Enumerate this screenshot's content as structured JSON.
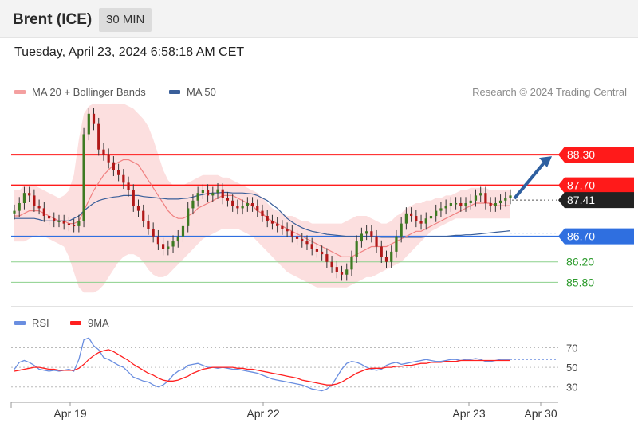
{
  "header": {
    "title": "Brent (ICE)",
    "interval": "30 MIN"
  },
  "datetime": "Tuesday, April 23, 2024 6:58:18 AM CET",
  "legend": {
    "ma20": {
      "label": "MA 20 + Bollinger Bands",
      "color": "#f08080"
    },
    "ma50": {
      "label": "MA 50",
      "color": "#3a5f9a"
    }
  },
  "credit": "Research © 2024 Trading Central",
  "rsi_legend": {
    "rsi": {
      "label": "RSI",
      "color": "#6a8ee0"
    },
    "ma9": {
      "label": "9MA",
      "color": "#ff2020"
    }
  },
  "chart_data": [
    {
      "type": "candlestick",
      "ylim": [
        85.4,
        89.3
      ],
      "levels": [
        {
          "value": 88.3,
          "label": "88.30",
          "kind": "resistance",
          "color": "#ff1a1a"
        },
        {
          "value": 87.7,
          "label": "87.70",
          "kind": "resistance",
          "color": "#ff1a1a"
        },
        {
          "value": 87.41,
          "label": "87.41",
          "kind": "last",
          "color": "#222222"
        },
        {
          "value": 86.7,
          "label": "86.70",
          "kind": "pivot",
          "color": "#2f6fe0"
        },
        {
          "value": 86.2,
          "label": "86.20",
          "kind": "support",
          "color": "#2eaa2e"
        },
        {
          "value": 85.8,
          "label": "85.80",
          "kind": "support",
          "color": "#2eaa2e"
        }
      ],
      "xticks": [
        "Apr 19",
        "Apr 22",
        "Apr 23",
        "Apr 30"
      ],
      "series_close": [
        87.2,
        87.35,
        87.55,
        87.5,
        87.3,
        87.25,
        87.1,
        87.05,
        87.0,
        87.0,
        86.95,
        86.92,
        86.9,
        87.0,
        88.7,
        89.1,
        88.9,
        88.4,
        88.3,
        88.15,
        88.0,
        87.9,
        87.75,
        87.6,
        87.3,
        87.2,
        87.0,
        86.85,
        86.7,
        86.55,
        86.45,
        86.5,
        86.6,
        86.7,
        86.9,
        87.25,
        87.4,
        87.55,
        87.6,
        87.5,
        87.55,
        87.62,
        87.45,
        87.4,
        87.3,
        87.25,
        87.3,
        87.35,
        87.3,
        87.2,
        87.1,
        87.0,
        86.95,
        86.9,
        86.85,
        86.8,
        86.7,
        86.65,
        86.6,
        86.55,
        86.45,
        86.4,
        86.35,
        86.2,
        86.1,
        86.0,
        85.95,
        86.05,
        86.3,
        86.6,
        86.75,
        86.8,
        86.7,
        86.5,
        86.3,
        86.2,
        86.4,
        86.7,
        86.95,
        87.15,
        87.1,
        87.0,
        86.95,
        87.05,
        87.1,
        87.2,
        87.25,
        87.3,
        87.35,
        87.35,
        87.3,
        87.35,
        87.4,
        87.5,
        87.55,
        87.35,
        87.3,
        87.35,
        87.4,
        87.45,
        87.5
      ],
      "ma20": [
        87.1,
        87.1,
        87.15,
        87.2,
        87.2,
        87.2,
        87.15,
        87.1,
        87.05,
        87.0,
        87.0,
        86.95,
        86.95,
        87.0,
        87.2,
        87.4,
        87.6,
        87.75,
        87.9,
        88.0,
        88.1,
        88.15,
        88.2,
        88.2,
        88.15,
        88.1,
        87.95,
        87.8,
        87.65,
        87.5,
        87.35,
        87.2,
        87.1,
        87.05,
        87.05,
        87.1,
        87.15,
        87.25,
        87.3,
        87.35,
        87.4,
        87.45,
        87.5,
        87.5,
        87.5,
        87.45,
        87.4,
        87.35,
        87.3,
        87.2,
        87.15,
        87.05,
        87.0,
        86.95,
        86.9,
        86.85,
        86.8,
        86.75,
        86.7,
        86.65,
        86.6,
        86.55,
        86.5,
        86.45,
        86.4,
        86.35,
        86.3,
        86.3,
        86.3,
        86.35,
        86.4,
        86.45,
        86.5,
        86.5,
        86.5,
        86.5,
        86.55,
        86.6,
        86.65,
        86.7,
        86.75,
        86.8,
        86.8,
        86.85,
        86.9,
        86.95,
        87.0,
        87.05,
        87.1,
        87.15,
        87.2,
        87.25,
        87.3,
        87.35,
        87.35,
        87.35,
        87.35,
        87.3,
        87.3,
        87.3,
        87.3
      ],
      "upper_band": [
        87.6,
        87.6,
        87.7,
        87.7,
        87.7,
        87.65,
        87.6,
        87.55,
        87.5,
        87.45,
        87.5,
        87.6,
        87.9,
        88.6,
        89.1,
        89.25,
        89.3,
        89.3,
        89.3,
        89.3,
        89.3,
        89.3,
        89.3,
        89.25,
        89.2,
        89.1,
        89.0,
        88.85,
        88.6,
        88.3,
        88.0,
        87.8,
        87.7,
        87.7,
        87.7,
        87.75,
        87.8,
        87.85,
        87.9,
        87.9,
        87.9,
        87.9,
        87.85,
        87.85,
        87.8,
        87.75,
        87.7,
        87.65,
        87.6,
        87.55,
        87.45,
        87.35,
        87.25,
        87.2,
        87.15,
        87.1,
        87.1,
        87.05,
        87.0,
        87.0,
        86.95,
        86.95,
        86.95,
        86.95,
        86.95,
        86.95,
        86.95,
        87.0,
        87.05,
        87.1,
        87.1,
        87.1,
        87.05,
        87.0,
        86.95,
        86.95,
        87.0,
        87.1,
        87.15,
        87.25,
        87.3,
        87.35,
        87.35,
        87.4,
        87.4,
        87.45,
        87.45,
        87.5,
        87.5,
        87.55,
        87.6,
        87.6,
        87.65,
        87.65,
        87.65,
        87.65,
        87.6,
        87.6,
        87.6,
        87.6,
        87.6
      ],
      "lower_band": [
        86.6,
        86.6,
        86.6,
        86.65,
        86.7,
        86.72,
        86.7,
        86.65,
        86.6,
        86.55,
        86.5,
        86.3,
        86.0,
        85.7,
        85.6,
        85.6,
        85.6,
        85.65,
        85.75,
        85.9,
        86.05,
        86.2,
        86.3,
        86.35,
        86.35,
        86.3,
        86.2,
        86.05,
        85.95,
        85.9,
        85.9,
        85.95,
        86.05,
        86.15,
        86.25,
        86.35,
        86.45,
        86.55,
        86.65,
        86.7,
        86.75,
        86.8,
        86.85,
        86.85,
        86.85,
        86.85,
        86.8,
        86.75,
        86.7,
        86.6,
        86.5,
        86.4,
        86.3,
        86.2,
        86.1,
        86.0,
        85.95,
        85.9,
        85.85,
        85.8,
        85.75,
        85.7,
        85.7,
        85.7,
        85.7,
        85.7,
        85.7,
        85.7,
        85.75,
        85.8,
        85.85,
        85.9,
        85.9,
        85.95,
        86.0,
        86.05,
        86.1,
        86.15,
        86.2,
        86.3,
        86.4,
        86.5,
        86.6,
        86.7,
        86.8,
        86.85,
        86.9,
        86.95,
        87.0,
        87.05,
        87.05,
        87.05,
        87.05,
        87.05,
        87.05,
        87.05,
        87.05,
        87.05,
        87.05,
        87.05,
        87.05
      ],
      "ma50": [
        87.05,
        87.05,
        87.05,
        87.05,
        87.05,
        87.03,
        87.0,
        87.0,
        87.0,
        87.0,
        87.0,
        87.0,
        87.05,
        87.1,
        87.2,
        87.28,
        87.35,
        87.4,
        87.43,
        87.45,
        87.47,
        87.48,
        87.5,
        87.5,
        87.5,
        87.5,
        87.48,
        87.47,
        87.46,
        87.45,
        87.44,
        87.43,
        87.43,
        87.43,
        87.44,
        87.45,
        87.47,
        87.5,
        87.52,
        87.54,
        87.55,
        87.55,
        87.56,
        87.56,
        87.55,
        87.55,
        87.55,
        87.54,
        87.53,
        87.5,
        87.45,
        87.4,
        87.32,
        87.25,
        87.15,
        87.05,
        86.98,
        86.92,
        86.87,
        86.83,
        86.8,
        86.78,
        86.76,
        86.74,
        86.73,
        86.72,
        86.71,
        86.7,
        86.7,
        86.7,
        86.7,
        86.7,
        86.7,
        86.69,
        86.68,
        86.68,
        86.68,
        86.68,
        86.68,
        86.68,
        86.68,
        86.68,
        86.68,
        86.69,
        86.7,
        86.7,
        86.7,
        86.7,
        86.71,
        86.72,
        86.72,
        86.73,
        86.73,
        86.74,
        86.75,
        86.76,
        86.77,
        86.78,
        86.79,
        86.8,
        86.81
      ],
      "forecast_arrow": {
        "from": 87.41,
        "to": 88.3
      }
    },
    {
      "type": "line",
      "ylim": [
        20,
        85
      ],
      "yticks": [
        30,
        50,
        70
      ],
      "series": [
        {
          "name": "RSI",
          "values": [
            48,
            55,
            57,
            55,
            52,
            48,
            47,
            46,
            47,
            46,
            47,
            48,
            46,
            58,
            78,
            80,
            72,
            68,
            60,
            58,
            55,
            52,
            50,
            45,
            40,
            38,
            36,
            35,
            32,
            30,
            32,
            36,
            42,
            46,
            48,
            52,
            53,
            54,
            52,
            50,
            50,
            49,
            50,
            49,
            48,
            48,
            47,
            46,
            45,
            44,
            42,
            40,
            38,
            37,
            36,
            35,
            34,
            33,
            32,
            30,
            28,
            27,
            26,
            28,
            32,
            40,
            48,
            54,
            56,
            55,
            53,
            50,
            48,
            47,
            48,
            52,
            54,
            55,
            53,
            54,
            55,
            56,
            57,
            58,
            57,
            56,
            56,
            57,
            58,
            58,
            57,
            58,
            58,
            59,
            58,
            56,
            56,
            57,
            58,
            58,
            58
          ]
        },
        {
          "name": "9MA",
          "values": [
            46,
            47,
            48,
            49,
            50,
            50,
            49,
            48,
            48,
            47,
            47,
            47,
            47,
            49,
            53,
            58,
            62,
            65,
            67,
            68,
            66,
            63,
            60,
            57,
            53,
            50,
            47,
            44,
            42,
            39,
            37,
            36,
            36,
            37,
            39,
            41,
            44,
            46,
            48,
            49,
            50,
            50,
            50,
            50,
            50,
            49,
            49,
            48,
            48,
            47,
            46,
            45,
            44,
            43,
            42,
            41,
            40,
            39,
            37,
            36,
            35,
            34,
            33,
            32,
            32,
            33,
            35,
            38,
            41,
            44,
            46,
            48,
            49,
            49,
            49,
            50,
            50,
            51,
            51,
            52,
            52,
            53,
            54,
            54,
            55,
            55,
            55,
            56,
            56,
            56,
            57,
            57,
            57,
            57,
            57,
            57,
            57,
            57,
            57,
            57,
            57
          ]
        }
      ],
      "xticks": [
        "Apr 19",
        "Apr 22",
        "Apr 23",
        "Apr 30"
      ]
    }
  ]
}
